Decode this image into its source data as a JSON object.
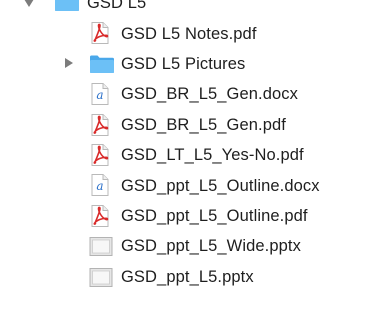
{
  "file_list": {
    "items": [
      {
        "name": "GSD L5",
        "kind": "folder",
        "level": 0,
        "expanded": true,
        "icon": "folder-icon",
        "color": "#5cb4f0"
      },
      {
        "name": "GSD L5 Notes.pdf",
        "kind": "pdf",
        "level": 1,
        "icon": "pdf-file-icon",
        "color": "#d92b2b"
      },
      {
        "name": "GSD L5 Pictures",
        "kind": "folder",
        "level": 1,
        "expanded": false,
        "icon": "folder-icon",
        "color": "#5cb4f0"
      },
      {
        "name": "GSD_BR_L5_Gen.docx",
        "kind": "docx",
        "level": 1,
        "icon": "docx-file-icon",
        "color": "#2a6fc9"
      },
      {
        "name": "GSD_BR_L5_Gen.pdf",
        "kind": "pdf",
        "level": 1,
        "icon": "pdf-file-icon",
        "color": "#d92b2b"
      },
      {
        "name": "GSD_LT_L5_Yes-No.pdf",
        "kind": "pdf",
        "level": 1,
        "icon": "pdf-file-icon",
        "color": "#d92b2b"
      },
      {
        "name": "GSD_ppt_L5_Outline.docx",
        "kind": "docx",
        "level": 1,
        "icon": "docx-file-icon",
        "color": "#2a6fc9"
      },
      {
        "name": "GSD_ppt_L5_Outline.pdf",
        "kind": "pdf",
        "level": 1,
        "icon": "pdf-file-icon",
        "color": "#d92b2b"
      },
      {
        "name": "GSD_ppt_L5_Wide.pptx",
        "kind": "pptx",
        "level": 1,
        "icon": "pptx-file-icon",
        "color": "#bdbdbd"
      },
      {
        "name": "GSD_ppt_L5.pptx",
        "kind": "pptx",
        "level": 1,
        "icon": "pptx-file-icon",
        "color": "#bdbdbd"
      }
    ]
  }
}
